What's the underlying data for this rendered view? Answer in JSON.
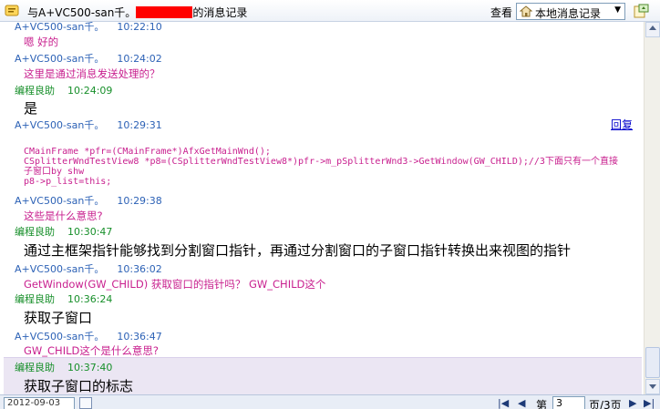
{
  "header": {
    "title_prefix": "与A+VC500-san千。",
    "title_suffix": "的消息记录",
    "view_label": "查看",
    "view_select": "本地消息记录"
  },
  "messages": [
    {
      "sender": "A+VC500-san千。",
      "time": "10:22:10",
      "text": "嗯 好的",
      "sender_type": "other"
    },
    {
      "sender": "A+VC500-san千。",
      "time": "10:24:02",
      "text": "这里是通过消息发送处理的？",
      "sender_type": "other"
    },
    {
      "sender": "编程良助",
      "time": "10:24:09",
      "text": "是",
      "sender_type": "self"
    },
    {
      "sender": "A+VC500-san千。",
      "time": "10:29:31",
      "reply": "回复",
      "code": "CMainFrame *pfr=(CMainFrame*)AfxGetMainWnd();\nCSplitterWndTestView8 *p8=(CSplitterWndTestView8*)pfr->m_pSplitterWnd3->GetWindow(GW_CHILD);//3下面只有一个直接\n子窗口by shw\np8->p_list=this;",
      "sender_type": "other"
    },
    {
      "sender": "A+VC500-san千。",
      "time": "10:29:38",
      "text": "这些是什么意思?",
      "sender_type": "other"
    },
    {
      "sender": "编程良助",
      "time": "10:30:47",
      "text": "通过主框架指针能够找到分割窗口指针，再通过分割窗口的子窗口指针转换出来视图的指针",
      "sender_type": "self"
    },
    {
      "sender": "A+VC500-san千。",
      "time": "10:36:02",
      "text": "GetWindow(GW_CHILD) 获取窗口的指针吗？ GW_CHILD这个",
      "sender_type": "other"
    },
    {
      "sender": "编程良助",
      "time": "10:36:24",
      "text": "获取子窗口",
      "sender_type": "self"
    },
    {
      "sender": "A+VC500-san千。",
      "time": "10:36:47",
      "text": "GW_CHILD这个是什么意思?",
      "sender_type": "other"
    },
    {
      "sender": "编程良助",
      "time": "10:37:40",
      "text": "获取子窗口的标志",
      "sender_type": "self"
    }
  ],
  "footer": {
    "date": "2012-09-03",
    "nav_first": "|◀",
    "nav_prev": "◀",
    "page_label": "第",
    "page_current": "3",
    "page_total": "页/3页",
    "nav_next": "▶",
    "nav_last": "▶|"
  },
  "colors": {
    "other_sender": "#2d62b6",
    "self_sender": "#178f2a",
    "pink_text": "#c81f8e",
    "redaction": "#ff0000",
    "highlight": "#ebe6f3"
  }
}
